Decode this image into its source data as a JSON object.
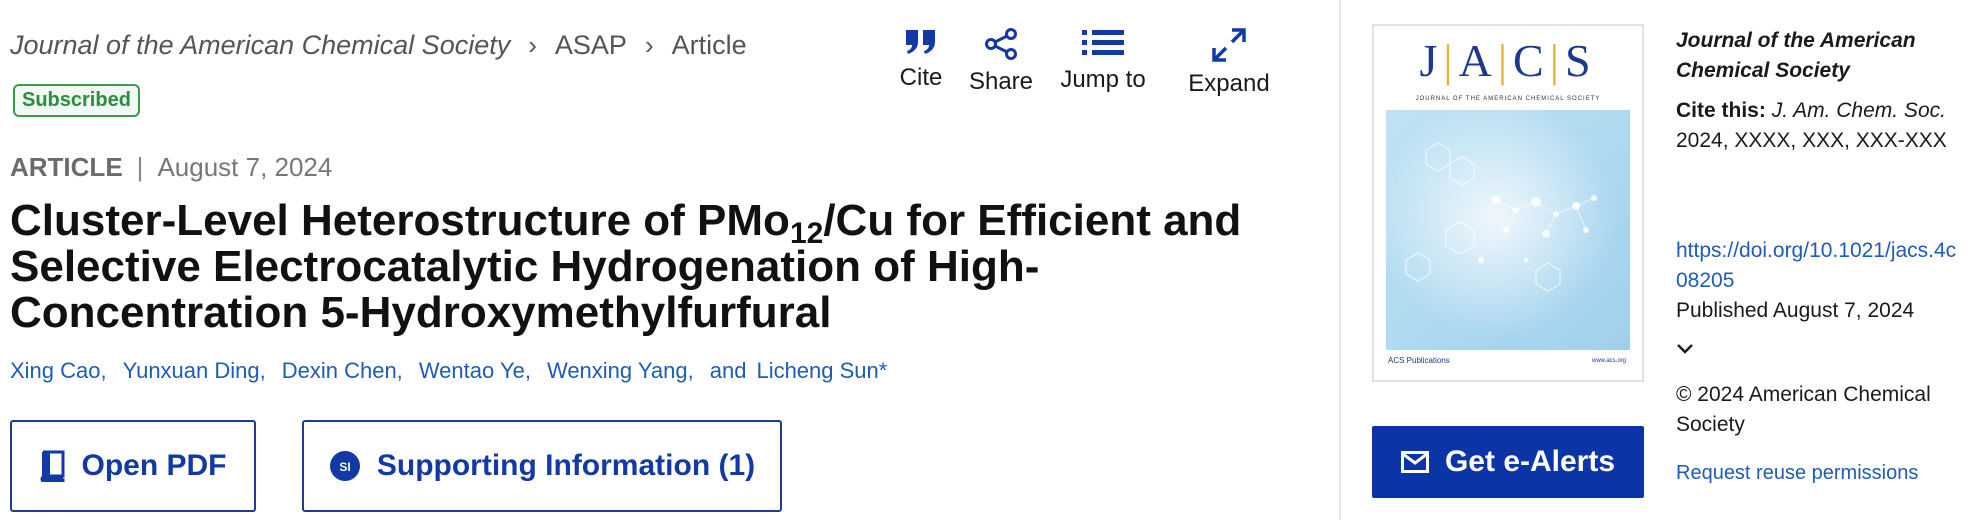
{
  "breadcrumb": {
    "journal": "Journal of the American Chemical Society",
    "section": "ASAP",
    "page": "Article"
  },
  "badge": "Subscribed",
  "toolbar": [
    {
      "label": "Cite",
      "icon": "quote-icon"
    },
    {
      "label": "Share",
      "icon": "share-icon"
    },
    {
      "label": "Jump to",
      "icon": "list-icon"
    },
    {
      "label": "Expand",
      "icon": "expand-icon"
    }
  ],
  "article": {
    "type": "ARTICLE",
    "date": "August 7, 2024",
    "title_part1": "Cluster-Level Heterostructure of PMo",
    "title_sub": "12",
    "title_part2": "/Cu for Efficient and Selective Electrocatalytic Hydrogenation of High-Concentration 5-Hydroxymethylfurfural",
    "authors": [
      "Xing Cao,",
      "Yunxuan Ding,",
      "Dexin Chen,",
      "Wentao Ye,",
      "Wenxing Yang,"
    ],
    "and_text": "and",
    "last_author": "Licheng Sun*"
  },
  "buttons": {
    "pdf": "Open PDF",
    "si": "Supporting Information (1)",
    "si_badge": "SI"
  },
  "cover": {
    "title": "JACS",
    "subtitle": "JOURNAL OF THE AMERICAN CHEMICAL SOCIETY",
    "publisher": "ACS Publications",
    "site": "www.acs.org"
  },
  "alerts": "Get e-Alerts",
  "side": {
    "journal": "Journal of the American Chemical Society",
    "cite_label": "Cite this:",
    "cite_abbr": "J. Am. Chem. Soc.",
    "cite_rest": "2024, XXXX, XXX, XXX-XXX",
    "doi": "https://doi.org/10.1021/jacs.4c08205",
    "published": "Published August 7, 2024",
    "copyright": "© 2024 American Chemical Society",
    "reuse": "Request reuse permissions"
  },
  "colors": {
    "link": "#1f5bb8",
    "primary": "#0b35a6",
    "badge_green": "#2f8a44"
  }
}
